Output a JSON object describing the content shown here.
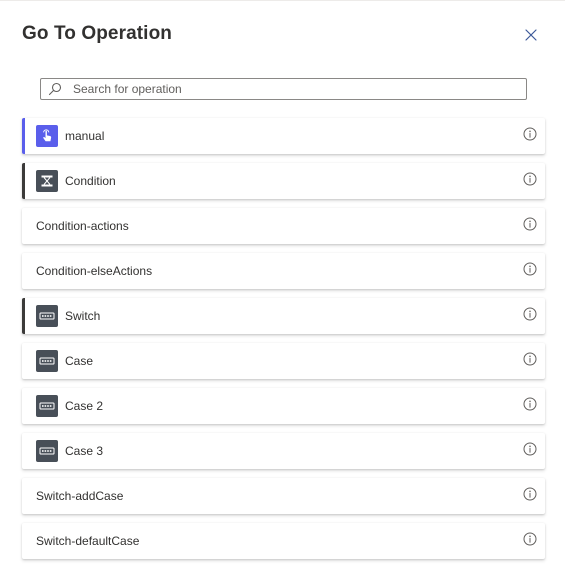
{
  "dialog": {
    "title": "Go To Operation",
    "close_icon": "close-icon"
  },
  "search": {
    "placeholder": "Search for operation",
    "value": "",
    "icon": "search-icon"
  },
  "colors": {
    "manual_badge": "#5a5eeb",
    "manual_accent": "#5a5eeb",
    "control_badge": "#484f58",
    "control_accent": "#3b3a39"
  },
  "operations": [
    {
      "label": "manual",
      "badge": "touch-icon",
      "badge_color": "#5a5eeb",
      "accent": "#5a5eeb"
    },
    {
      "label": "Condition",
      "badge": "condition-icon",
      "badge_color": "#484f58",
      "accent": "#3b3a39"
    },
    {
      "label": "Condition-actions",
      "badge": "",
      "badge_color": "",
      "accent": ""
    },
    {
      "label": "Condition-elseActions",
      "badge": "",
      "badge_color": "",
      "accent": ""
    },
    {
      "label": "Switch",
      "badge": "switch-icon",
      "badge_color": "#484f58",
      "accent": "#3b3a39"
    },
    {
      "label": "Case",
      "badge": "switch-icon",
      "badge_color": "#484f58",
      "accent": ""
    },
    {
      "label": "Case 2",
      "badge": "switch-icon",
      "badge_color": "#484f58",
      "accent": ""
    },
    {
      "label": "Case 3",
      "badge": "switch-icon",
      "badge_color": "#484f58",
      "accent": ""
    },
    {
      "label": "Switch-addCase",
      "badge": "",
      "badge_color": "",
      "accent": ""
    },
    {
      "label": "Switch-defaultCase",
      "badge": "",
      "badge_color": "",
      "accent": ""
    }
  ]
}
